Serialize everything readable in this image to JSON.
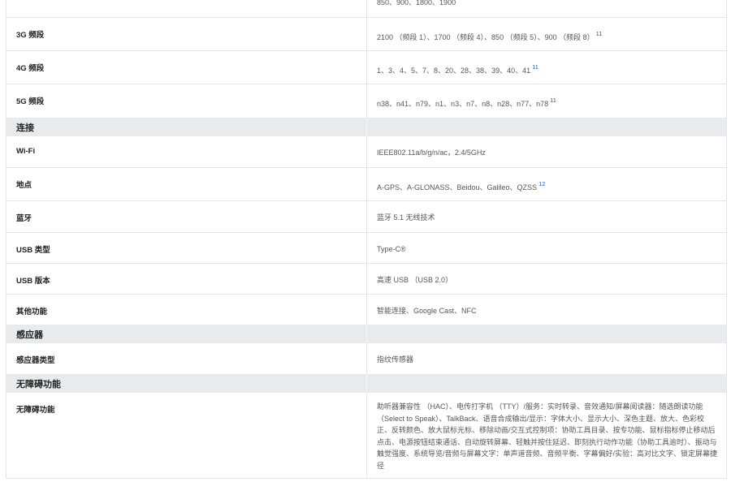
{
  "rows_top": [
    {
      "label": "",
      "value": "850、900、1800、1900",
      "sup": "",
      "h": 28
    },
    {
      "label": "3G 频段",
      "value": "2100 （频段 1）、1700 （频段 4）、850 （频段 5）、900 （频段 8）",
      "sup": "11",
      "h": 41
    },
    {
      "label": "4G 频段",
      "value": "1、3、4、5、7、8、20、28、38、39、40、41",
      "sup": "11",
      "h": 41
    },
    {
      "label": "5G 频段",
      "value": "n38、n41、n79、n1、n3、n7、n8、n28、n77、n78",
      "sup": "11",
      "h": 41
    }
  ],
  "sections": {
    "connectivity": "连接",
    "sensors": "感应器",
    "accessibility": "无障碍功能"
  },
  "connectivity_rows": [
    {
      "label": "Wi-Fi",
      "value": "IEEE802.11a/b/g/n/ac，2.4/5GHz",
      "sup": ""
    },
    {
      "label": "地点",
      "value": "A-GPS、A-GLONASS、Beidou、Galileo、QZSS",
      "sup": "12"
    },
    {
      "label": "蓝牙",
      "value": "蓝牙 5.1 无线技术",
      "sup": ""
    },
    {
      "label": "USB 类型",
      "value": "Type-C®",
      "sup": ""
    },
    {
      "label": "USB 版本",
      "value": "高速 USB （USB 2.0）",
      "sup": ""
    },
    {
      "label": "其他功能",
      "value": "智能连接、Google Cast、NFC",
      "sup": ""
    }
  ],
  "sensor_rows": [
    {
      "label": "感应器类型",
      "value": "指纹传感器",
      "sup": ""
    }
  ],
  "accessibility_rows": [
    {
      "label": "无障碍功能",
      "value": "助听器兼容性 （HAC）、电传打字机 （TTY）/服务：实时转录、音效通知/屏幕阅读器：随选朗读功能（Select to Speak）、TalkBack、语音合成输出/显示：字体大小、显示大小、深色主题、放大、色彩校正、反转颜色、放大鼠标光标、移除动画/交互式控制项：协助工具目录、按专功能、鼠标指标停止移动后点击、电源按钮结束通话、自动旋转屏幕、轻触并按住延迟、即刻执行动作功能（协助工具逾时）、振动与触觉强度、系统导览/音频与屏幕文字：单声道音频、音频平衡、字幕偏好/实验：高对比文字、锁定屏幕捷径",
      "sup": ""
    }
  ]
}
